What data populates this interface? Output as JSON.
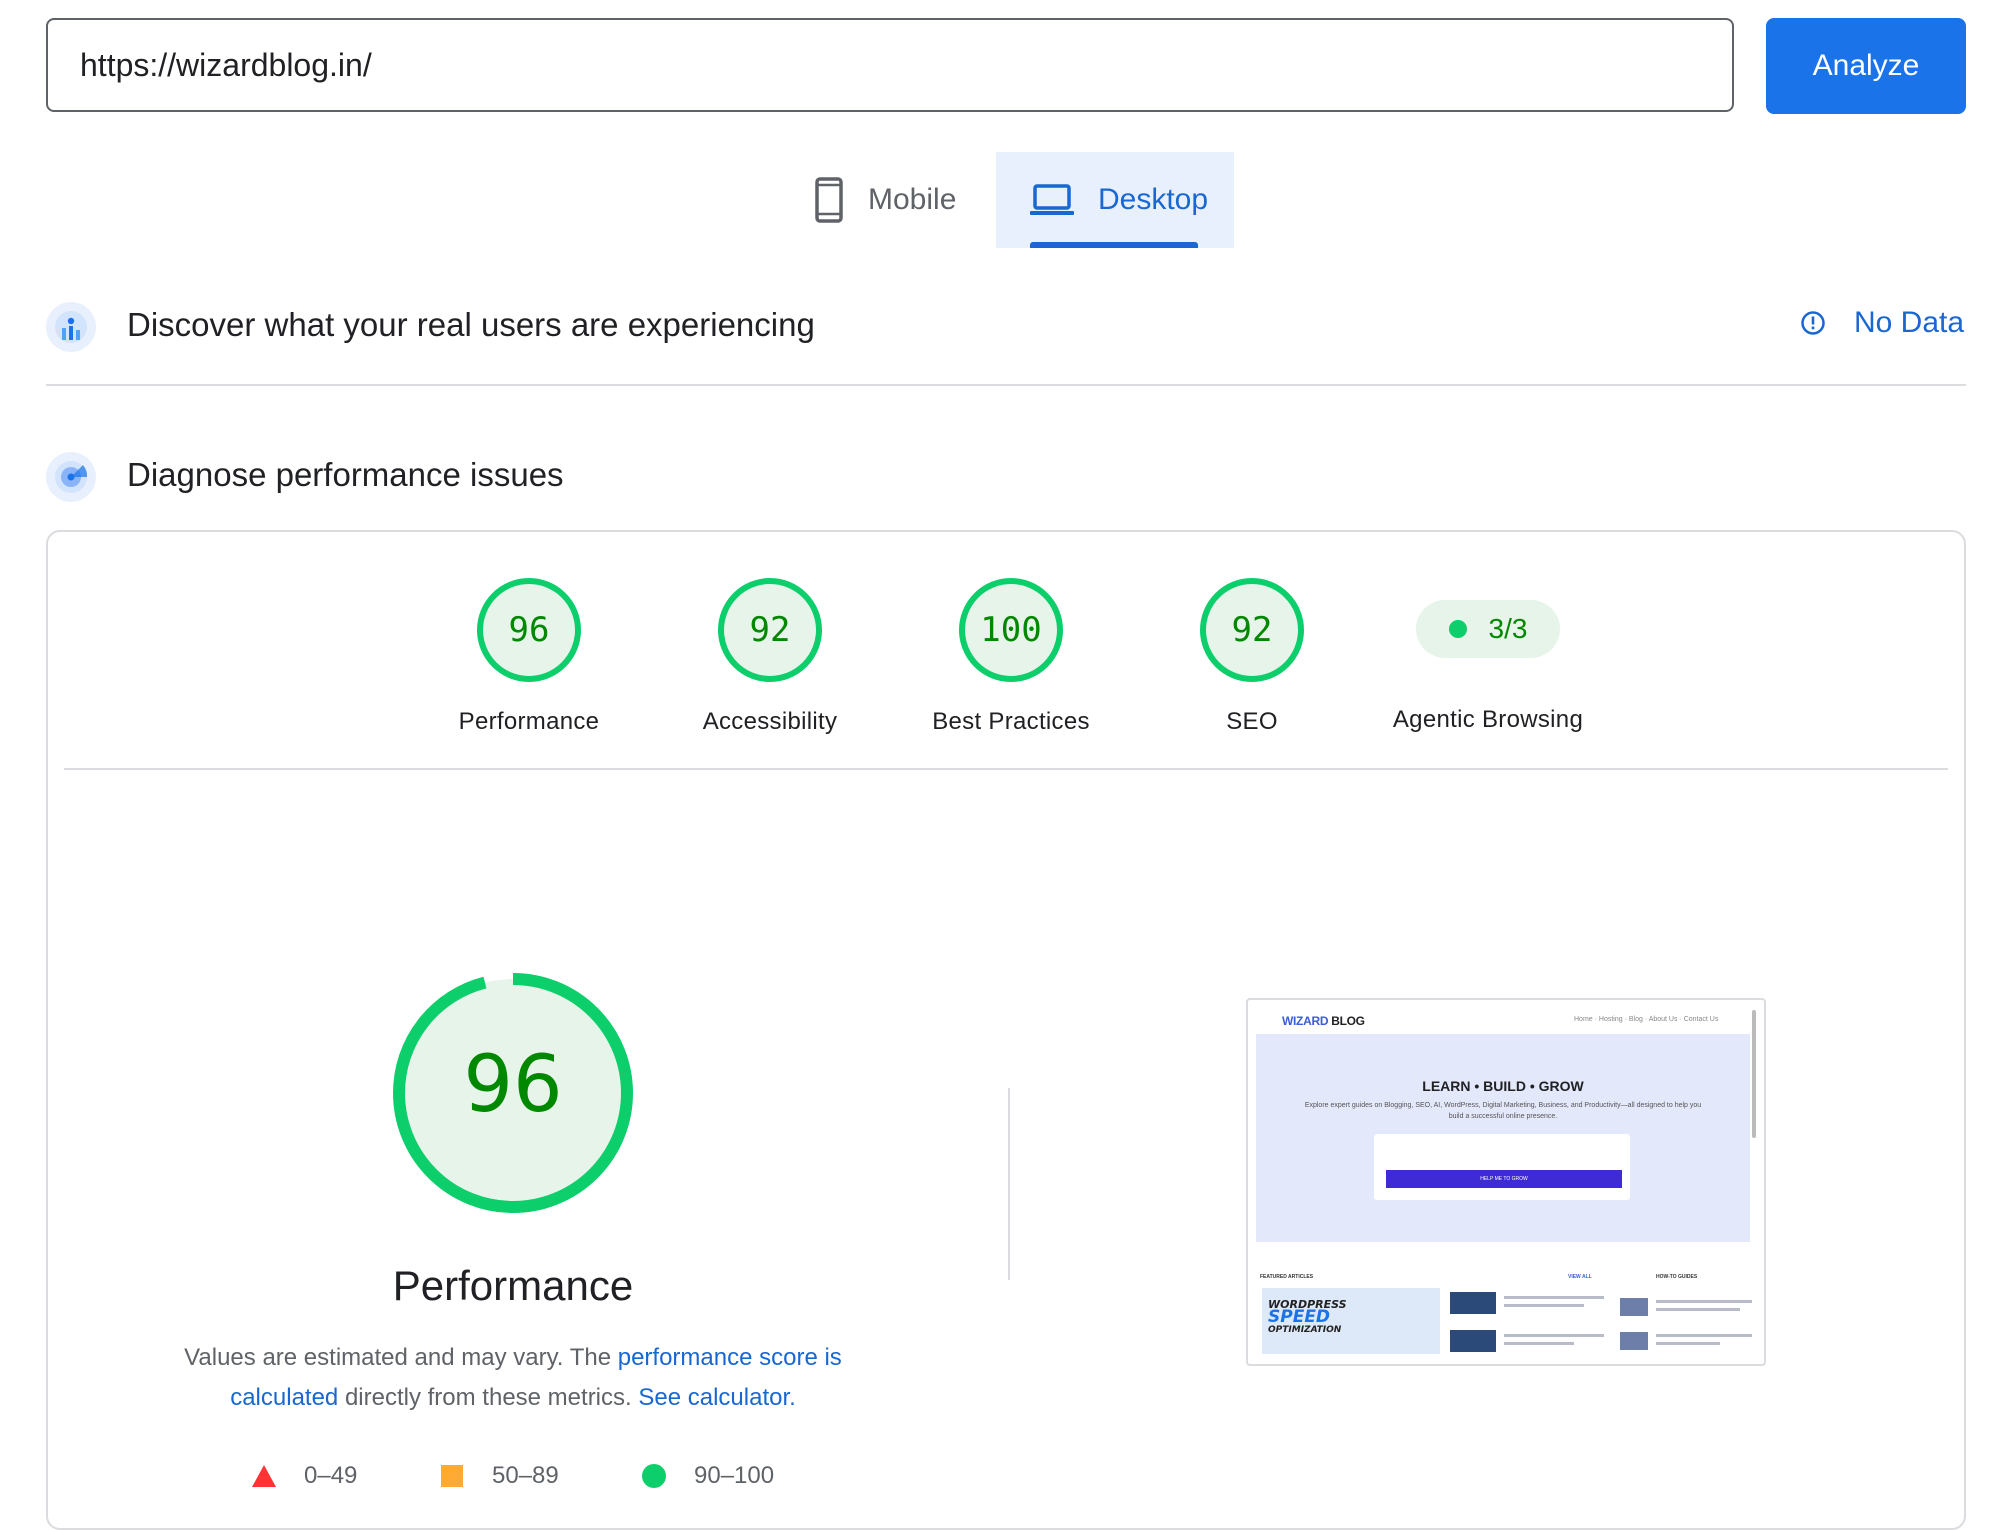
{
  "search": {
    "url_value": "https://wizardblog.in/",
    "analyze_label": "Analyze"
  },
  "device_tabs": {
    "mobile_label": "Mobile",
    "desktop_label": "Desktop",
    "selected": "Desktop"
  },
  "crux_section": {
    "title": "Discover what your real users are experiencing",
    "status_label": "No Data"
  },
  "diagnose_section": {
    "title": "Diagnose performance issues"
  },
  "scores": [
    {
      "value": "96",
      "label": "Performance"
    },
    {
      "value": "92",
      "label": "Accessibility"
    },
    {
      "value": "100",
      "label": "Best Practices"
    },
    {
      "value": "92",
      "label": "SEO"
    }
  ],
  "agentic": {
    "value": "3/3",
    "label": "Agentic Browsing"
  },
  "performance_detail": {
    "score": "96",
    "score_fraction": 0.96,
    "title": "Performance",
    "desc_part1": "Values are estimated and may vary. The ",
    "desc_link1": "performance score is calculated",
    "desc_part2": " directly from these metrics. ",
    "desc_link2": "See calculator."
  },
  "legend": [
    {
      "range": "0–49",
      "shape": "triangle",
      "color": "#ff3333"
    },
    {
      "range": "50–89",
      "shape": "square",
      "color": "#ffaa33"
    },
    {
      "range": "90–100",
      "shape": "circle",
      "color": "#0cce6b"
    }
  ],
  "screenshot": {
    "logo_wizard": "WIZARD",
    "logo_blog": " BLOG",
    "nav": "Home · Hosting · Blog · About Us · Contact Us",
    "hero_title": "LEARN • BUILD • GROW",
    "hero_sub": "Explore expert guides on Blogging, SEO, AI, WordPress, Digital Marketing, Business, and Productivity—all designed to help you build a successful online presence.",
    "form_button": "HELP ME TO GROW",
    "featured_heading": "FEATURED ARTICLES",
    "view_all": "VIEW ALL",
    "howto_heading": "HOW-TO GUIDES",
    "feat_line1": "WORDPRESS",
    "feat_line2": "SPEED",
    "feat_line3": "OPTIMIZATION"
  },
  "colors": {
    "accent": "#1a73e8",
    "pass_green": "#0cce6b",
    "pass_text": "#008800",
    "pass_bg": "#e6f4ea"
  },
  "icons": {
    "mobile": "phone-icon",
    "desktop": "laptop-icon",
    "crux": "users-chart-icon",
    "diagnose": "radar-icon",
    "info": "info-icon"
  }
}
